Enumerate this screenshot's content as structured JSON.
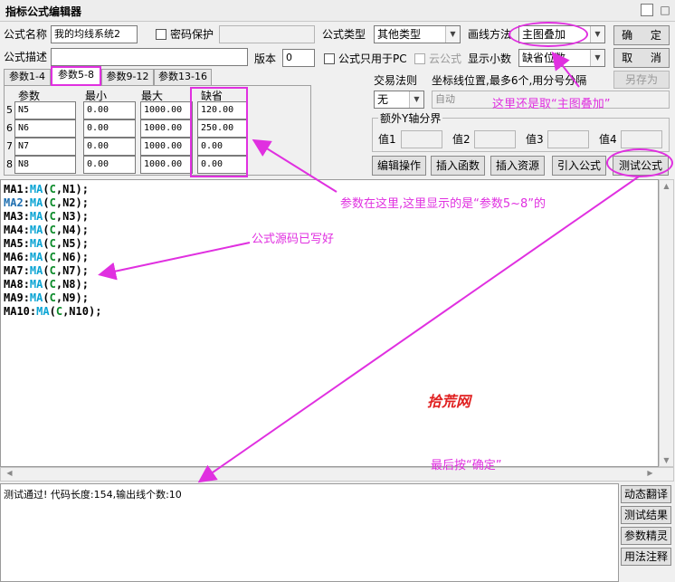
{
  "window": {
    "title": "指标公式编辑器"
  },
  "form": {
    "name_label": "公式名称",
    "name_value": "我的均线系统2",
    "password_label": "密码保护",
    "type_label": "公式类型",
    "type_value": "其他类型",
    "draw_label": "画线方法",
    "draw_value": "主图叠加",
    "desc_label": "公式描述",
    "version_label": "版本",
    "version_value": "0",
    "pc_only_label": "公式只用于PC",
    "cloud_label": "云公式",
    "decimals_label": "显示小数",
    "decimals_value": "缺省位数"
  },
  "buttons": {
    "ok": "确 定",
    "cancel": "取 消",
    "save_as": "另存为",
    "edit_op": "编辑操作",
    "insert_func": "插入函数",
    "insert_res": "插入资源",
    "import": "引入公式",
    "test": "测试公式"
  },
  "tabs": [
    {
      "label": "参数1-4"
    },
    {
      "label": "参数5-8"
    },
    {
      "label": "参数9-12"
    },
    {
      "label": "参数13-16"
    }
  ],
  "params": {
    "headers": [
      "参数",
      "最小",
      "最大",
      "缺省"
    ],
    "rows": [
      {
        "num": "5",
        "name": "N5",
        "min": "0.00",
        "max": "1000.00",
        "default": "120.00"
      },
      {
        "num": "6",
        "name": "N6",
        "min": "0.00",
        "max": "1000.00",
        "default": "250.00"
      },
      {
        "num": "7",
        "name": "N7",
        "min": "0.00",
        "max": "1000.00",
        "default": "0.00"
      },
      {
        "num": "8",
        "name": "N8",
        "min": "0.00",
        "max": "1000.00",
        "default": "0.00"
      }
    ]
  },
  "trade": {
    "rule_label": "交易法则",
    "rule_value": "无",
    "coord_label": "坐标线位置,最多6个,用分号分隔",
    "coord_value": "自动"
  },
  "yaxis": {
    "title": "额外Y轴分界",
    "labels": [
      "值1",
      "值2",
      "值3",
      "值4"
    ]
  },
  "code": [
    {
      "name": "MA1",
      "arg": "N1"
    },
    {
      "name": "MA2",
      "arg": "N2"
    },
    {
      "name": "MA3",
      "arg": "N3"
    },
    {
      "name": "MA4",
      "arg": "N4"
    },
    {
      "name": "MA5",
      "arg": "N5"
    },
    {
      "name": "MA6",
      "arg": "N6"
    },
    {
      "name": "MA7",
      "arg": "N7"
    },
    {
      "name": "MA8",
      "arg": "N8"
    },
    {
      "name": "MA9",
      "arg": "N9"
    },
    {
      "name": "MA10",
      "arg": "N10"
    }
  ],
  "code_tokens": {
    "fn": "MA",
    "src": "C"
  },
  "output": {
    "text": "测试通过! 代码长度:154,输出线个数:10"
  },
  "side_buttons": [
    "动态翻译",
    "测试结果",
    "参数精灵",
    "用法注释"
  ],
  "annotations": {
    "draw_note": "这里还是取“主图叠加”",
    "params_note": "参数在这里,这里显示的是“参数5~8”的",
    "code_note": "公式源码已写好",
    "watermark": "拾荒网",
    "final_note": "最后按“确定”"
  },
  "colors": {
    "annotation": "#e030e0",
    "watermark": "#e02020",
    "function": "#0aa4d4",
    "source_var": "#0a8a28"
  }
}
